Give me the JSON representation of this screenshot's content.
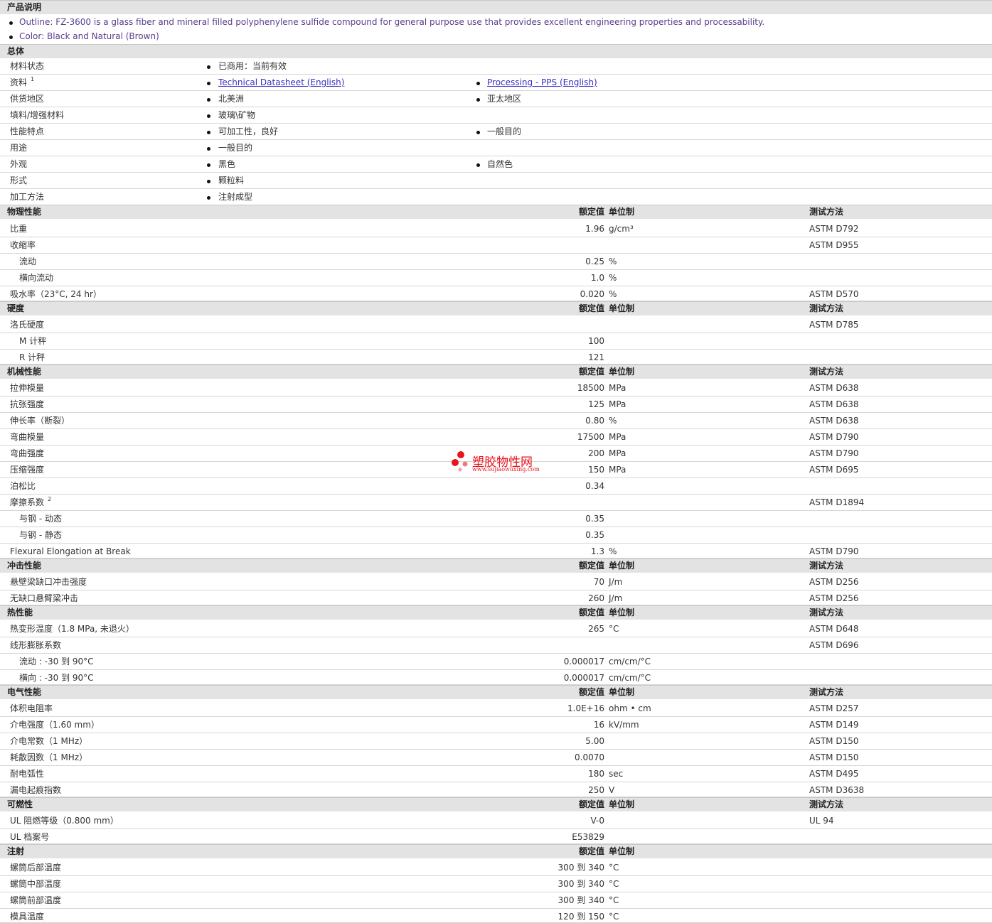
{
  "product": {
    "title": "产品说明",
    "bullets": [
      "Outline: FZ-3600 is a glass fiber and mineral filled polyphenylene sulfide compound for general purpose use that provides excellent engineering properties and processability.",
      "Color: Black and Natural (Brown)"
    ]
  },
  "general": {
    "title": "总体",
    "rows": [
      {
        "label": "材料状态",
        "c1": "已商用：当前有效",
        "c2": ""
      },
      {
        "label": "资料",
        "sup": "1",
        "c1": "Technical Datasheet (English)",
        "c2": "Processing - PPS (English)"
      },
      {
        "label": "供货地区",
        "c1": "北美洲",
        "c2": "亚太地区"
      },
      {
        "label": "填料/增强材料",
        "c1": "玻璃\\矿物",
        "c2": ""
      },
      {
        "label": "性能特点",
        "c1": "可加工性，良好",
        "c2": "一般目的"
      },
      {
        "label": "用途",
        "c1": "一般目的",
        "c2": ""
      },
      {
        "label": "外观",
        "c1": "黑色",
        "c2": "自然色"
      },
      {
        "label": "形式",
        "c1": "颗粒料",
        "c2": ""
      },
      {
        "label": "加工方法",
        "c1": "注射成型",
        "c2": ""
      }
    ]
  },
  "headers": {
    "value": "额定值",
    "unit": "单位制",
    "method": "测试方法"
  },
  "sections": [
    {
      "title": "物理性能",
      "show_method": true,
      "rows": [
        {
          "label": "比重",
          "value": "1.96",
          "unit": "g/cm³",
          "method": "ASTM D792"
        },
        {
          "label": "收缩率",
          "value": "",
          "unit": "",
          "method": "ASTM D955"
        },
        {
          "label": "流动",
          "indent": true,
          "value": "0.25",
          "unit": "%",
          "method": ""
        },
        {
          "label": "横向流动",
          "indent": true,
          "value": "1.0",
          "unit": "%",
          "method": ""
        },
        {
          "label": "吸水率（23°C, 24 hr）",
          "value": "0.020",
          "unit": "%",
          "method": "ASTM D570"
        }
      ]
    },
    {
      "title": "硬度",
      "show_method": true,
      "rows": [
        {
          "label": "洛氏硬度",
          "value": "",
          "unit": "",
          "method": "ASTM D785"
        },
        {
          "label": "M 计秤",
          "indent": true,
          "value": "100",
          "unit": "",
          "method": ""
        },
        {
          "label": "R 计秤",
          "indent": true,
          "value": "121",
          "unit": "",
          "method": ""
        }
      ]
    },
    {
      "title": "机械性能",
      "show_method": true,
      "rows": [
        {
          "label": "拉伸模量",
          "value": "18500",
          "unit": "MPa",
          "method": "ASTM D638"
        },
        {
          "label": "抗张强度",
          "value": "125",
          "unit": "MPa",
          "method": "ASTM D638"
        },
        {
          "label": "伸长率（断裂）",
          "value": "0.80",
          "unit": "%",
          "method": "ASTM D638"
        },
        {
          "label": "弯曲模量",
          "value": "17500",
          "unit": "MPa",
          "method": "ASTM D790"
        },
        {
          "label": "弯曲强度",
          "value": "200",
          "unit": "MPa",
          "method": "ASTM D790"
        },
        {
          "label": "压缩强度",
          "value": "150",
          "unit": "MPa",
          "method": "ASTM D695"
        },
        {
          "label": "泊松比",
          "value": "0.34",
          "unit": "",
          "method": ""
        },
        {
          "label": "摩擦系数",
          "sup": "2",
          "value": "",
          "unit": "",
          "method": "ASTM D1894"
        },
        {
          "label": "与钢 - 动态",
          "indent": true,
          "value": "0.35",
          "unit": "",
          "method": ""
        },
        {
          "label": "与钢 - 静态",
          "indent": true,
          "value": "0.35",
          "unit": "",
          "method": ""
        },
        {
          "label": "Flexural Elongation at Break",
          "value": "1.3",
          "unit": "%",
          "method": "ASTM D790"
        }
      ]
    },
    {
      "title": "冲击性能",
      "show_method": true,
      "rows": [
        {
          "label": "悬壁梁缺口冲击强度",
          "value": "70",
          "unit": "J/m",
          "method": "ASTM D256"
        },
        {
          "label": "无缺口悬臂梁冲击",
          "value": "260",
          "unit": "J/m",
          "method": "ASTM D256"
        }
      ]
    },
    {
      "title": "热性能",
      "show_method": true,
      "rows": [
        {
          "label": "热变形温度（1.8 MPa, 未退火）",
          "value": "265",
          "unit": "°C",
          "method": "ASTM D648"
        },
        {
          "label": "线形膨胀系数",
          "value": "",
          "unit": "",
          "method": "ASTM D696"
        },
        {
          "label": "流动 : -30 到 90°C",
          "indent": true,
          "value": "0.000017",
          "unit": "cm/cm/°C",
          "method": ""
        },
        {
          "label": "横向 : -30 到 90°C",
          "indent": true,
          "value": "0.000017",
          "unit": "cm/cm/°C",
          "method": ""
        }
      ]
    },
    {
      "title": "电气性能",
      "show_method": true,
      "rows": [
        {
          "label": "体积电阻率",
          "value": "1.0E+16",
          "unit": "ohm • cm",
          "method": "ASTM D257"
        },
        {
          "label": "介电强度（1.60 mm）",
          "value": "16",
          "unit": "kV/mm",
          "method": "ASTM D149"
        },
        {
          "label": "介电常数（1 MHz）",
          "value": "5.00",
          "unit": "",
          "method": "ASTM D150"
        },
        {
          "label": "耗散因数（1 MHz）",
          "value": "0.0070",
          "unit": "",
          "method": "ASTM D150"
        },
        {
          "label": "耐电弧性",
          "value": "180",
          "unit": "sec",
          "method": "ASTM D495"
        },
        {
          "label": "漏电起痕指数",
          "value": "250",
          "unit": "V",
          "method": "ASTM D3638"
        }
      ]
    },
    {
      "title": "可燃性",
      "show_method": true,
      "rows": [
        {
          "label": "UL 阻燃等级（0.800 mm）",
          "value": "V-0",
          "unit": "",
          "method": "UL 94"
        },
        {
          "label": "UL 档案号",
          "value": "E53829",
          "unit": "",
          "method": ""
        }
      ]
    },
    {
      "title": "注射",
      "show_method": false,
      "rows": [
        {
          "label": "螺筒后部温度",
          "value": "300 到 340",
          "unit": "°C",
          "method": ""
        },
        {
          "label": "螺筒中部温度",
          "value": "300 到 340",
          "unit": "°C",
          "method": ""
        },
        {
          "label": "螺筒前部温度",
          "value": "300 到 340",
          "unit": "°C",
          "method": ""
        },
        {
          "label": "模具温度",
          "value": "120 到 150",
          "unit": "°C",
          "method": ""
        }
      ]
    }
  ],
  "watermark": {
    "name": "塑胶物性网",
    "url": "www.sujiaowuxing.com"
  },
  "colors": {
    "section_bg": "#e3e3e3",
    "link": "#3a2ec0",
    "purple_text": "#5a3e8c",
    "watermark": "#e8141c"
  }
}
